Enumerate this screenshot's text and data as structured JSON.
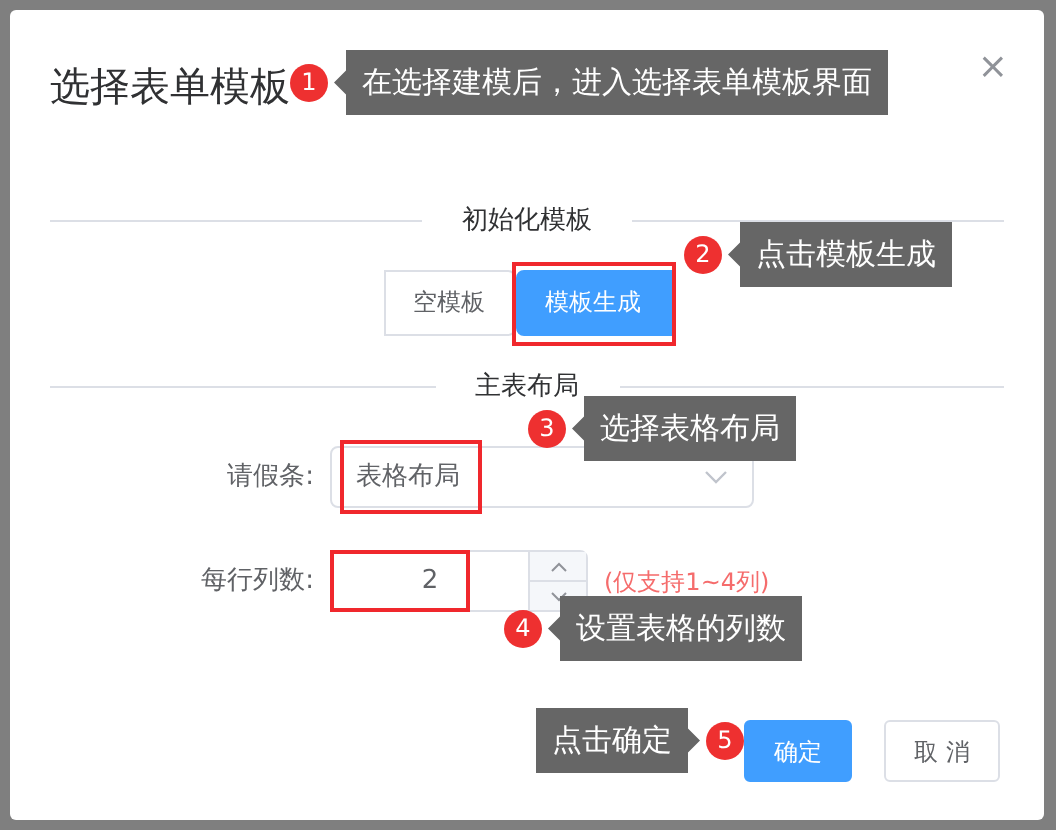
{
  "dialog": {
    "title": "选择表单模板",
    "close": "×"
  },
  "template_section": {
    "title": "初始化模板",
    "options": [
      {
        "label": "空模板",
        "selected": false,
        "highlighted": false
      },
      {
        "label": "模板生成",
        "selected": true,
        "highlighted": true
      }
    ]
  },
  "layout_section": {
    "title": "主表布局",
    "fields": [
      {
        "kind": "select",
        "label": "请假条:",
        "value": "表格布局",
        "highlighted": true
      },
      {
        "kind": "number",
        "label": "每行列数:",
        "value": "2",
        "hint": "(仅支持1~4列)",
        "highlighted": true
      }
    ]
  },
  "buttons": [
    {
      "label": "确定",
      "primary": true
    },
    {
      "label": "取 消",
      "primary": false
    }
  ],
  "callouts": [
    {
      "number": "1",
      "text": "在选择建模后，进入选择表单模板界面"
    },
    {
      "number": "2",
      "text": "点击模板生成"
    },
    {
      "number": "3",
      "text": "选择表格布局"
    },
    {
      "number": "4",
      "text": "设置表格的列数"
    },
    {
      "number": "5",
      "text": "点击确定"
    }
  ]
}
